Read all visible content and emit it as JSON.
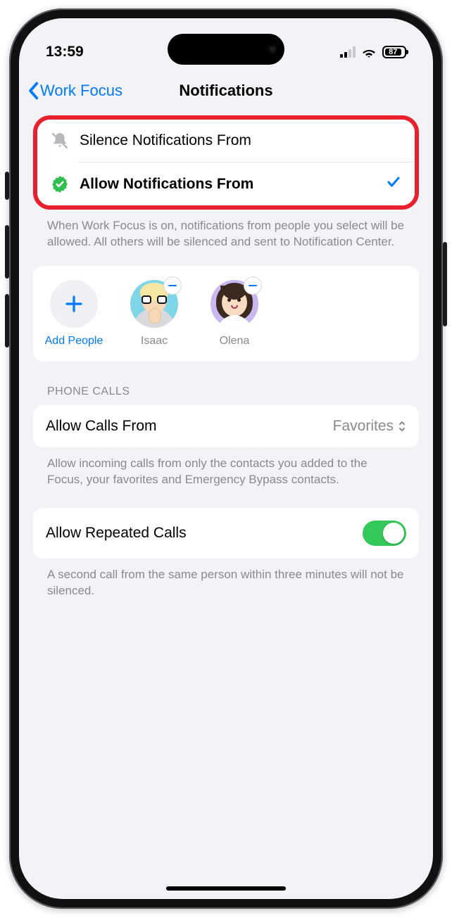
{
  "status": {
    "time": "13:59",
    "battery_pct": "87"
  },
  "nav": {
    "back": "Work Focus",
    "title": "Notifications"
  },
  "options": {
    "silence": {
      "label": "Silence Notifications From"
    },
    "allow": {
      "label": "Allow Notifications From"
    }
  },
  "options_footnote": "When Work Focus is on, notifications from people you select will be allowed. All others will be silenced and sent to Notification Center.",
  "people": {
    "add_label": "Add People",
    "items": [
      {
        "name": "Isaac"
      },
      {
        "name": "Olena"
      }
    ]
  },
  "calls_section": "PHONE CALLS",
  "allow_calls": {
    "label": "Allow Calls From",
    "value": "Favorites"
  },
  "allow_calls_footnote": "Allow incoming calls from only the contacts you added to the Focus, your favorites and Emergency Bypass contacts.",
  "repeated": {
    "label": "Allow Repeated Calls"
  },
  "repeated_footnote": "A second call from the same person within three minutes will not be silenced."
}
